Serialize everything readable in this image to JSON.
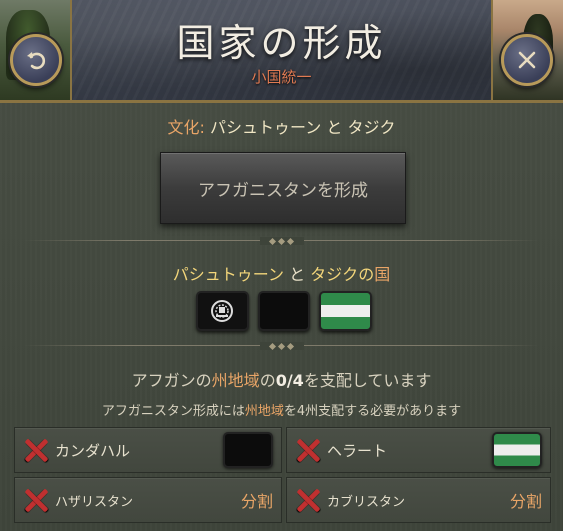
{
  "header": {
    "title": "国家の形成",
    "subtitle": "小国統一",
    "back_icon": "undo-arrow-icon",
    "close_icon": "close-x-icon"
  },
  "culture": {
    "prefix": "文化:",
    "culture1": "パシュトゥーン",
    "and": "と",
    "culture2": "タジク"
  },
  "form_button": "アフガニスタンを形成",
  "nations": {
    "culture1": "パシュトゥーン",
    "and": "と",
    "culture2": "タジク",
    "suffix_no": "の",
    "suffix_word": "国",
    "flags": [
      "emblem-flag",
      "black-flag",
      "green-white-green-flag"
    ]
  },
  "status": {
    "line1_a": "アフガンの",
    "line1_hl": "州地域",
    "line1_b": "の",
    "line1_num": "0/4",
    "line1_c": "を支配しています",
    "line2_a": "アフガニスタン形成には",
    "line2_hl": "州地域",
    "line2_b": "を",
    "line2_num": "4",
    "line2_c": "州支配する必要があります"
  },
  "regions": [
    {
      "name": "カンダハル",
      "flag": "black"
    },
    {
      "name": "ヘラート",
      "flag": "green-white-green"
    },
    {
      "name": "ハザリスタン",
      "status": "分割"
    },
    {
      "name": "カブリスタン",
      "status": "分割"
    }
  ],
  "colors": {
    "accent_orange": "#e9a567",
    "title_text": "#f2ede2",
    "missing_red": "#c03030",
    "panel_bg": "#3e443a"
  }
}
